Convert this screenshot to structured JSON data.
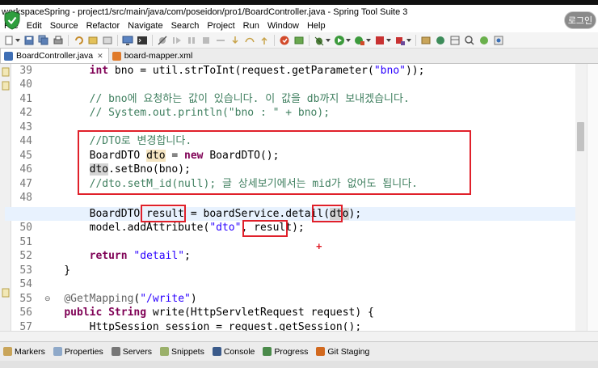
{
  "window": {
    "title": "workspaceSpring - project1/src/main/java/com/poseidon/pro1/BoardController.java - Spring Tool Suite 3",
    "login_label": "로그인"
  },
  "menu": [
    "File",
    "Edit",
    "Source",
    "Refactor",
    "Navigate",
    "Search",
    "Project",
    "Run",
    "Window",
    "Help"
  ],
  "tabs": [
    {
      "label": "BoardController.java",
      "icon": "java-file-icon",
      "active": true
    },
    {
      "label": "board-mapper.xml",
      "icon": "xml-file-icon",
      "active": false
    }
  ],
  "editor": {
    "lines": [
      {
        "num": "39",
        "code": "        int bno = util.strToInt(request.getParameter(\"bno\"));"
      },
      {
        "num": "40",
        "code": ""
      },
      {
        "num": "41",
        "code": "        // bno에 요청하는 값이 있습니다. 이 값을 db까지 보내겠습니다."
      },
      {
        "num": "42",
        "code": "        // System.out.println(\"bno : \" + bno);"
      },
      {
        "num": "43",
        "code": ""
      },
      {
        "num": "44",
        "code": "        //DTO로 변경합니다."
      },
      {
        "num": "45",
        "code": "        BoardDTO dto = new BoardDTO();"
      },
      {
        "num": "46",
        "code": "        dto.setBno(bno);"
      },
      {
        "num": "47",
        "code": "        //dto.setM_id(null); 글 상세보기에서는 mid가 없어도 됩니다."
      },
      {
        "num": "48",
        "code": ""
      },
      {
        "num": "49",
        "code": "        BoardDTO result = boardService.detail(dto);"
      },
      {
        "num": "50",
        "code": "        model.addAttribute(\"dto\", result);"
      },
      {
        "num": "51",
        "code": ""
      },
      {
        "num": "52",
        "code": "        return \"detail\";"
      },
      {
        "num": "53",
        "code": "    }"
      },
      {
        "num": "54",
        "code": ""
      },
      {
        "num": "55",
        "code": "    @GetMapping(\"/write\")"
      },
      {
        "num": "56",
        "code": "    public String write(HttpServletRequest request) {"
      },
      {
        "num": "57",
        "code": "        HttpSession session = request.getSession();"
      }
    ]
  },
  "views": [
    {
      "label": "Markers",
      "icon": "markers-icon"
    },
    {
      "label": "Properties",
      "icon": "properties-icon"
    },
    {
      "label": "Servers",
      "icon": "servers-icon"
    },
    {
      "label": "Snippets",
      "icon": "snippets-icon"
    },
    {
      "label": "Console",
      "icon": "console-icon"
    },
    {
      "label": "Progress",
      "icon": "progress-icon"
    },
    {
      "label": "Git Staging",
      "icon": "git-staging-icon"
    }
  ],
  "colors": {
    "keyword": "#7f0055",
    "string": "#2a00ff",
    "comment": "#3f7f5f",
    "annotation_box": "#e0202a",
    "current_line": "#e8f2fe"
  }
}
